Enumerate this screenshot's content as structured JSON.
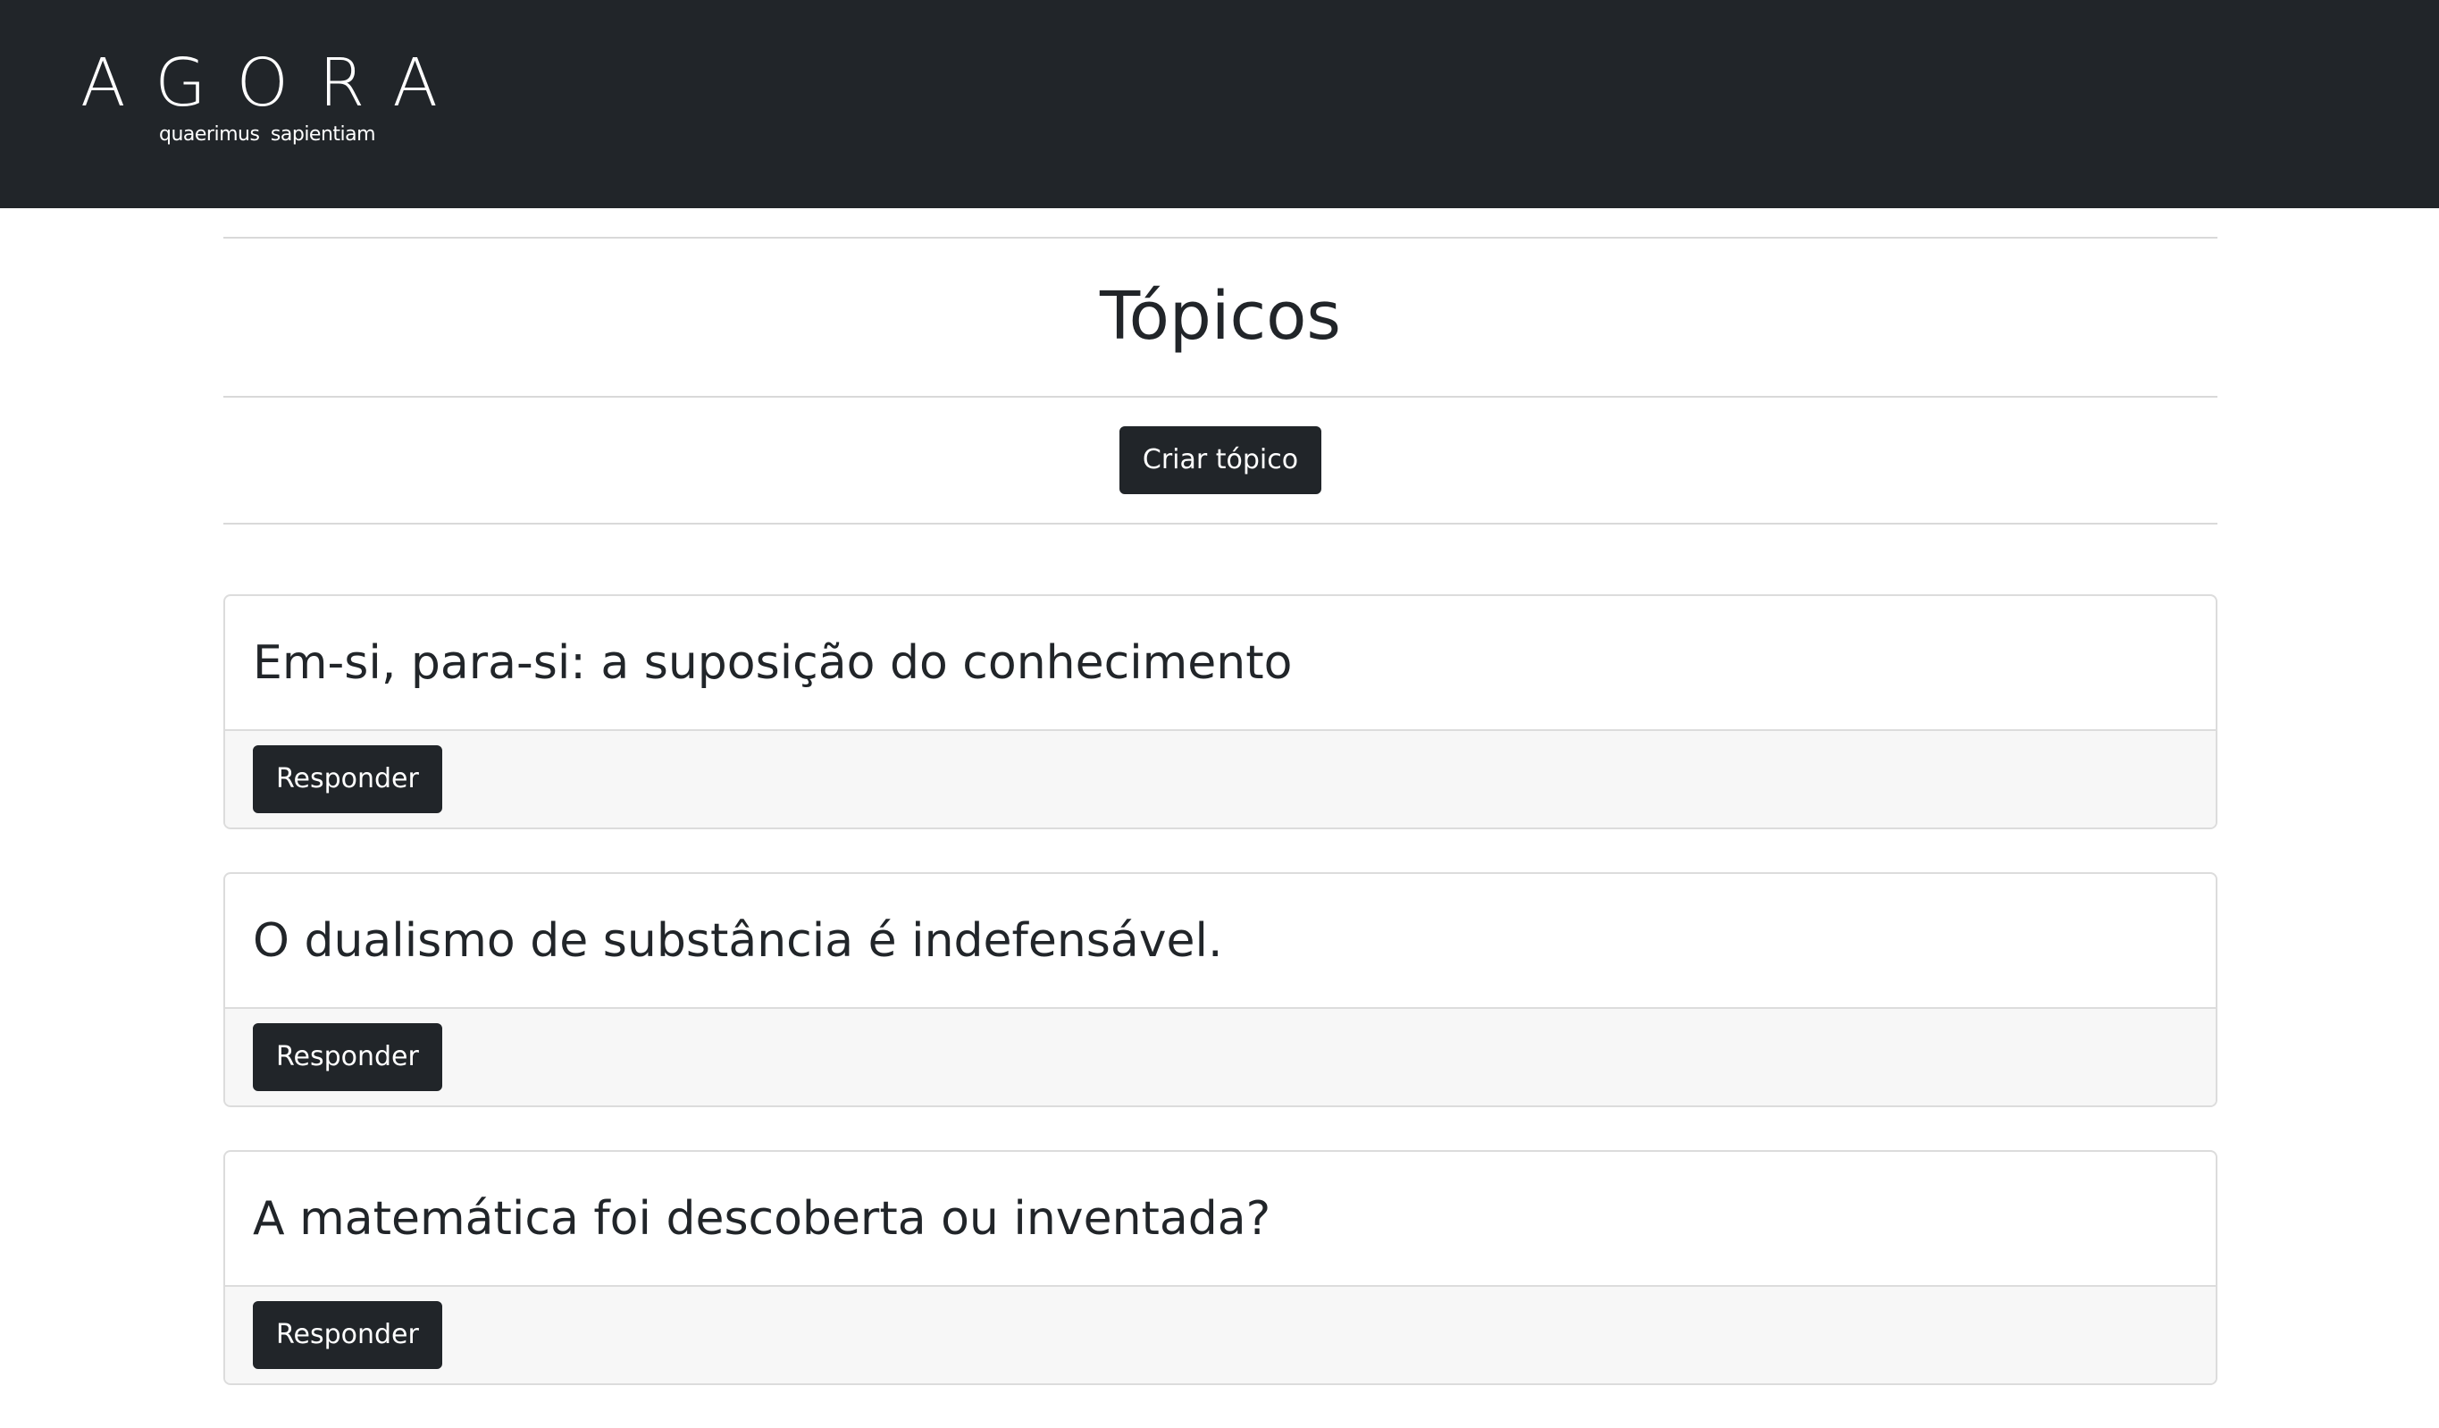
{
  "navbar": {
    "brand_name": "AGORA",
    "brand_tagline": "quaerimus sapientiam"
  },
  "page": {
    "title": "Tópicos",
    "create_button_label": "Criar tópico"
  },
  "topics": [
    {
      "title": "Em-si, para-si: a suposição do conhecimento",
      "reply_label": "Responder"
    },
    {
      "title": "O dualismo de substância é indefensável.",
      "reply_label": "Responder"
    },
    {
      "title": "A matemática foi descoberta ou inventada?",
      "reply_label": "Responder"
    }
  ],
  "colors": {
    "navbar_bg": "#212529",
    "button_bg": "#212529",
    "card_footer_bg": "#f7f7f7",
    "border": "#dcdcdc"
  }
}
